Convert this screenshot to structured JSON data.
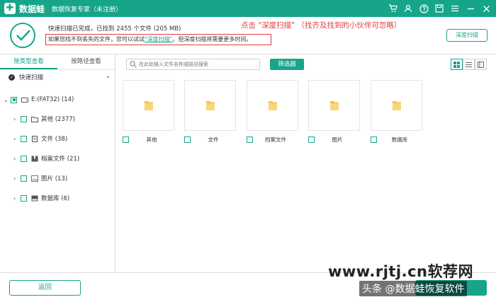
{
  "titlebar": {
    "logo_mark": "✚",
    "brand": "数据蛙",
    "app_title": "数据恢复专家（未注册）",
    "icons": [
      "cart-icon",
      "user-icon",
      "help-icon",
      "save-icon",
      "menu-icon",
      "minimize-icon",
      "close-icon"
    ]
  },
  "header": {
    "scan_status": "快速扫描已完成，已找到  2455  个文件  (205 MB)",
    "tip_prefix": "如果您找不到丢失的文件，您可以试试",
    "tip_link": "\"深度扫描\"",
    "tip_suffix": "。但深度扫描将需要更多时间。",
    "annotation": "点击 \"深度扫描\"  （找齐及找到的小伙伴可忽略）",
    "deep_scan_button": "深度扫描"
  },
  "sidebar": {
    "tabs": [
      {
        "label": "按类型查看",
        "active": true
      },
      {
        "label": "按路径查看",
        "active": false
      }
    ],
    "quick_scan_label": "快速扫描",
    "drive_label": "E:(FAT32) (14)",
    "items": [
      {
        "label": "其他 (2377)",
        "icon": "folder-icon"
      },
      {
        "label": "文件 (38)",
        "icon": "document-icon"
      },
      {
        "label": "档案文件 (21)",
        "icon": "archive-icon"
      },
      {
        "label": "图片 (13)",
        "icon": "image-icon"
      },
      {
        "label": "数据库 (6)",
        "icon": "database-icon"
      }
    ]
  },
  "toolbar": {
    "search_placeholder": "在此处输入文件名称或路径搜索",
    "filter_button": "筛选器"
  },
  "grid": {
    "tiles": [
      {
        "label": "其他"
      },
      {
        "label": "文件"
      },
      {
        "label": "档案文件"
      },
      {
        "label": "图片"
      },
      {
        "label": "数据库"
      }
    ]
  },
  "bottom": {
    "back_button": "返回"
  },
  "watermark": {
    "line1": "www.rjtj.cn软荐网",
    "line2": "头条 @数据蛙恢复软件"
  },
  "colors": {
    "accent": "#17a58a",
    "annotation_red": "#e23c3c",
    "folder": "#f5c451"
  }
}
